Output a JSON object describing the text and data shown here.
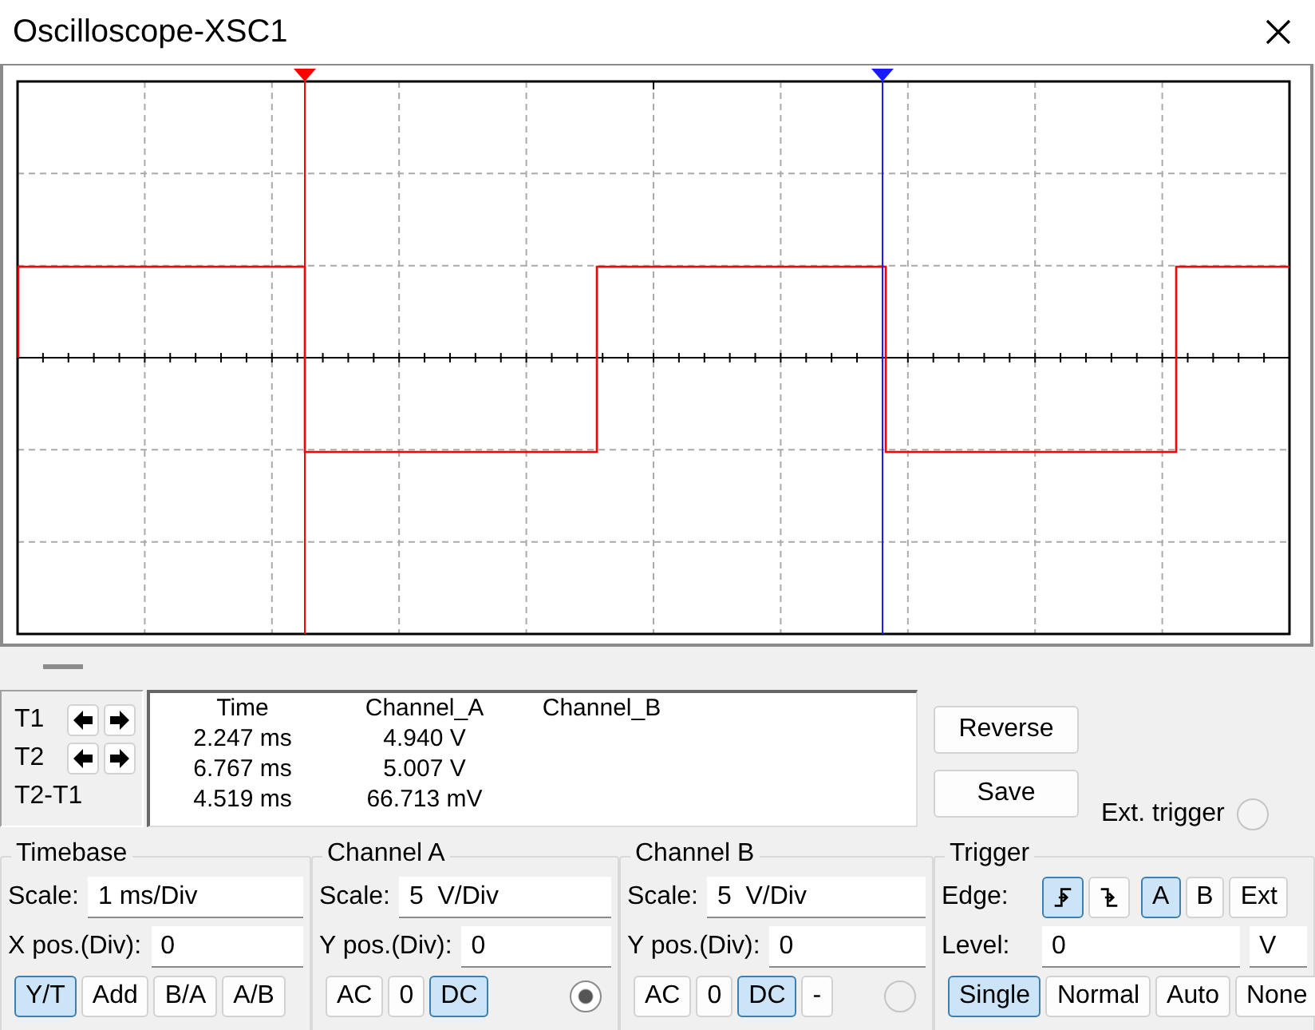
{
  "window": {
    "title": "Oscilloscope-XSC1"
  },
  "cursors": [
    {
      "label": "T1",
      "arrows": true
    },
    {
      "label": "T2",
      "arrows": true
    },
    {
      "label": "T2-T1",
      "arrows": false
    }
  ],
  "readout": {
    "columns": [
      "Time",
      "Channel_A",
      "Channel_B"
    ],
    "rows": [
      [
        "2.247 ms",
        "4.940 V"
      ],
      [
        "6.767 ms",
        "5.007 V"
      ],
      [
        "4.519 ms",
        "66.713 mV"
      ]
    ]
  },
  "actions": [
    {
      "label": "Reverse"
    },
    {
      "label": "Save"
    }
  ],
  "ext_trigger": {
    "label": "Ext. trigger",
    "checked": false
  },
  "groups": [
    {
      "title": "Timebase",
      "rows": [
        {
          "kind": "field",
          "label": "Scale:",
          "value": "1 ms/Div"
        },
        {
          "kind": "field",
          "label": "X pos.(Div):",
          "value": "0"
        },
        {
          "kind": "buttons",
          "buttons": [
            {
              "kind": "text",
              "label": "Y/T",
              "selected": true
            },
            {
              "kind": "text",
              "label": "Add",
              "selected": false
            },
            {
              "kind": "text",
              "label": "B/A",
              "selected": false
            },
            {
              "kind": "text",
              "label": "A/B",
              "selected": false
            }
          ]
        }
      ]
    },
    {
      "title": "Channel A",
      "rows": [
        {
          "kind": "field",
          "label": "Scale:",
          "value": "5  V/Div"
        },
        {
          "kind": "field",
          "label": "Y pos.(Div):",
          "value": "0"
        },
        {
          "kind": "buttons",
          "buttons": [
            {
              "kind": "text",
              "label": "AC",
              "selected": false
            },
            {
              "kind": "text",
              "label": "0",
              "selected": false
            },
            {
              "kind": "text",
              "label": "DC",
              "selected": true
            }
          ],
          "indicator": {
            "checked": true
          }
        }
      ]
    },
    {
      "title": "Channel B",
      "rows": [
        {
          "kind": "field",
          "label": "Scale:",
          "value": "5  V/Div"
        },
        {
          "kind": "field",
          "label": "Y pos.(Div):",
          "value": "0"
        },
        {
          "kind": "buttons",
          "buttons": [
            {
              "kind": "text",
              "label": "AC",
              "selected": false
            },
            {
              "kind": "text",
              "label": "0",
              "selected": false
            },
            {
              "kind": "text",
              "label": "DC",
              "selected": true
            },
            {
              "kind": "text",
              "label": "-",
              "selected": false
            }
          ],
          "indicator": {
            "checked": false
          }
        }
      ]
    },
    {
      "title": "Trigger",
      "rows": [
        {
          "kind": "buttons",
          "label": "Edge:",
          "buttons": [
            {
              "kind": "rising",
              "selected": true
            },
            {
              "kind": "falling",
              "selected": false
            },
            {
              "kind": "text",
              "label": "A",
              "selected": true
            },
            {
              "kind": "text",
              "label": "B",
              "selected": false
            },
            {
              "kind": "text",
              "label": "Ext",
              "selected": false
            }
          ]
        },
        {
          "kind": "field",
          "label": "Level:",
          "value": "0",
          "unit": "V"
        },
        {
          "kind": "buttons",
          "buttons": [
            {
              "kind": "text",
              "label": "Single",
              "selected": true
            },
            {
              "kind": "text",
              "label": "Normal",
              "selected": false
            },
            {
              "kind": "text",
              "label": "Auto",
              "selected": false
            },
            {
              "kind": "text",
              "label": "None",
              "selected": false
            }
          ]
        }
      ]
    }
  ]
}
